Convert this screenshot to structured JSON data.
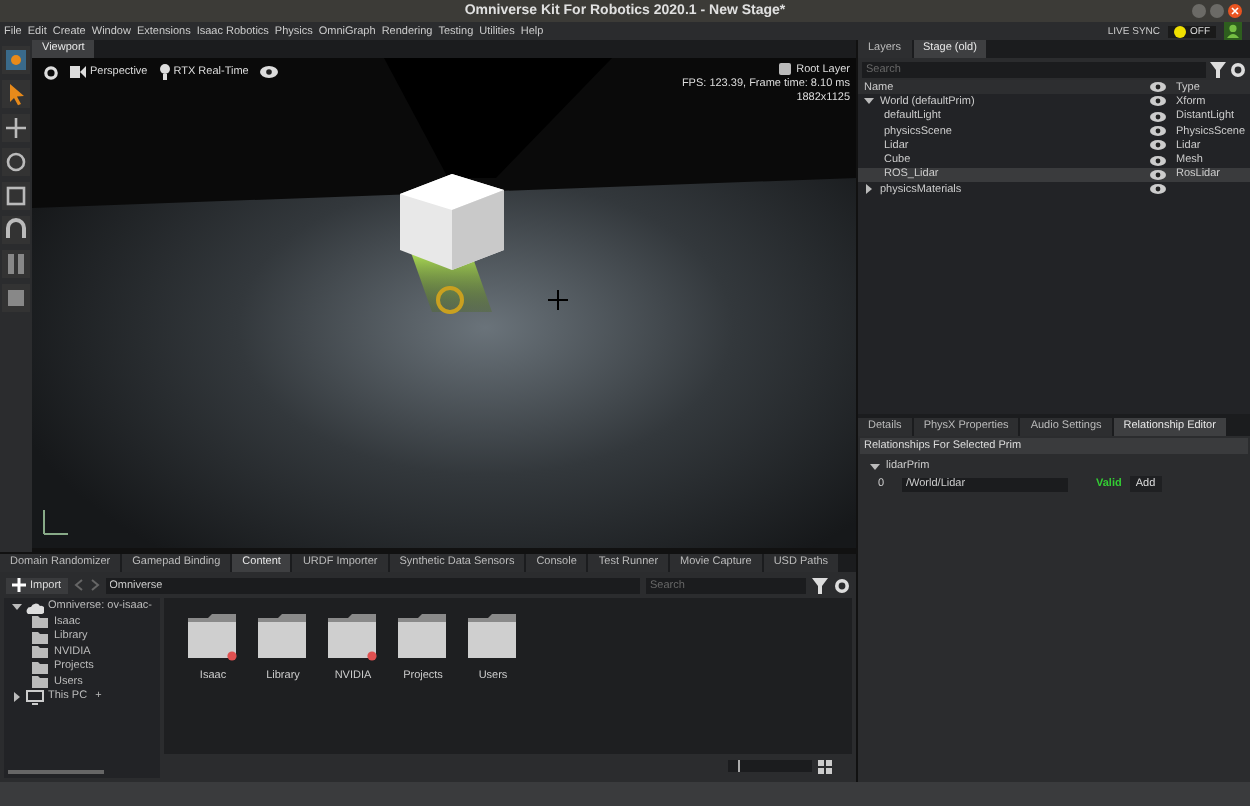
{
  "window": {
    "title": "Omniverse Kit For Robotics 2020.1 - New Stage*"
  },
  "menu_bar": [
    "File",
    "Edit",
    "Create",
    "Window",
    "Extensions",
    "Isaac Robotics",
    "Physics",
    "OmniGraph",
    "Rendering",
    "Testing",
    "Utilities",
    "Help"
  ],
  "live_sync": {
    "label": "LIVE SYNC",
    "state": "OFF",
    "on": false
  },
  "viewport": {
    "tab": "Viewport",
    "camera": "Perspective",
    "renderer": "RTX Real-Time",
    "layer": "Root Layer",
    "stats": [
      "FPS: 123.39, Frame time: 8.10 ms",
      "1882x1125"
    ]
  },
  "stage": {
    "tabs": [
      {
        "label": "Layers",
        "selected": false
      },
      {
        "label": "Stage (old)",
        "selected": true
      }
    ],
    "search": {
      "placeholder": "Search"
    },
    "columns": [
      "Name",
      "Type"
    ],
    "rows": [
      {
        "name": "World (defaultPrim)",
        "type": "Xform",
        "selected": false,
        "expanded": true,
        "children": [
          {
            "name": "defaultLight",
            "type": "DistantLight",
            "selected": false
          },
          {
            "name": "physicsScene",
            "type": "PhysicsScene",
            "selected": false
          },
          {
            "name": "Lidar",
            "type": "Lidar",
            "selected": false
          },
          {
            "name": "Cube",
            "type": "Mesh",
            "selected": false
          },
          {
            "name": "ROS_Lidar",
            "type": "RosLidar",
            "selected": true
          }
        ]
      },
      {
        "name": "physicsMaterials",
        "selected": false,
        "expanded": false
      }
    ]
  },
  "properties": {
    "tabs": [
      {
        "label": "Details",
        "selected": false
      },
      {
        "label": "PhysX Properties",
        "selected": false
      },
      {
        "label": "Audio Settings",
        "selected": false
      },
      {
        "label": "Relationship Editor",
        "selected": true
      }
    ],
    "header": "Relationships For Selected Prim",
    "group": {
      "name": "lidarPrim",
      "expanded": true,
      "entries": [
        {
          "index": "0",
          "path": "/World/Lidar",
          "status": "Valid"
        }
      ]
    },
    "add_button": "Add"
  },
  "bottom_tabs": [
    {
      "label": "Domain Randomizer",
      "selected": false
    },
    {
      "label": "Gamepad Binding",
      "selected": false
    },
    {
      "label": "Content",
      "selected": true
    },
    {
      "label": "URDF Importer",
      "selected": false
    },
    {
      "label": "Synthetic Data Sensors",
      "selected": false
    },
    {
      "label": "Console",
      "selected": false
    },
    {
      "label": "Test Runner",
      "selected": false
    },
    {
      "label": "Movie Capture",
      "selected": false
    },
    {
      "label": "USD Paths",
      "selected": false
    }
  ],
  "content": {
    "zoom": {
      "level": 0.12
    },
    "import_button": "Import",
    "path": "Omniverse",
    "search": {
      "placeholder": "Search"
    },
    "tree": [
      {
        "name": "Omniverse: ov-isaac-",
        "kind": "server",
        "expanded": true,
        "children": [
          {
            "name": "Isaac",
            "kind": "folder"
          },
          {
            "name": "Library",
            "kind": "folder"
          },
          {
            "name": "NVIDIA",
            "kind": "folder"
          },
          {
            "name": "Projects",
            "kind": "folder"
          },
          {
            "name": "Users",
            "kind": "folder"
          }
        ]
      },
      {
        "name": "This PC",
        "kind": "computer",
        "expanded": false,
        "add": "+"
      }
    ],
    "folders": [
      {
        "name": "Isaac",
        "badge": true
      },
      {
        "name": "Library",
        "badge": false
      },
      {
        "name": "NVIDIA",
        "badge": true
      },
      {
        "name": "Projects",
        "badge": false
      },
      {
        "name": "Users",
        "badge": false
      }
    ]
  }
}
